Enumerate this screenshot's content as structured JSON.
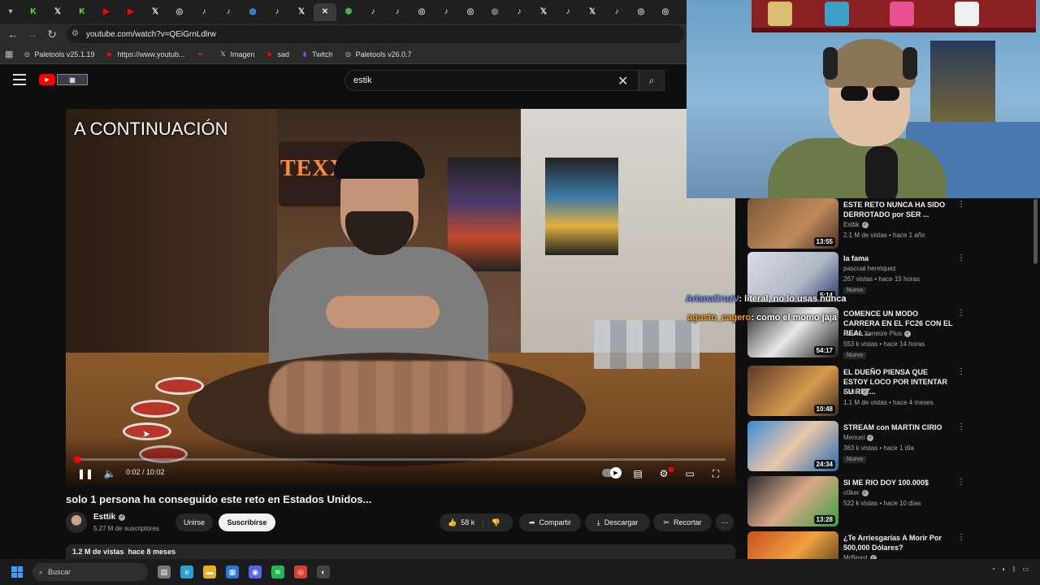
{
  "browser": {
    "tabs": [
      {
        "icon": "k-icon",
        "color": "#53fc18",
        "glyph": "K"
      },
      {
        "icon": "x-icon",
        "color": "#e7e7e7",
        "glyph": "𝕏"
      },
      {
        "icon": "k-icon",
        "color": "#53fc18",
        "glyph": "K"
      },
      {
        "icon": "youtube-icon",
        "color": "#ff0000",
        "glyph": "▶"
      },
      {
        "icon": "youtube-icon",
        "color": "#ff0000",
        "glyph": "▶"
      },
      {
        "icon": "x-icon",
        "color": "#e7e7e7",
        "glyph": "𝕏"
      },
      {
        "icon": "chrome-icon",
        "color": "#cfcfcf",
        "glyph": "◎"
      },
      {
        "icon": "tiktok-icon",
        "color": "#e7e7e7",
        "glyph": "♪"
      },
      {
        "icon": "tiktok-icon",
        "color": "#e7e7e7",
        "glyph": "♪"
      },
      {
        "icon": "globe-icon",
        "color": "#3aa0ff",
        "glyph": "◍"
      },
      {
        "icon": "tiktok-icon",
        "color": "#e7e7e7",
        "glyph": "♪"
      },
      {
        "icon": "x-icon",
        "color": "#e7e7e7",
        "glyph": "𝕏"
      },
      {
        "icon": "close-icon",
        "color": "#e7e7e7",
        "glyph": "✕",
        "active": true
      },
      {
        "icon": "shield-icon",
        "color": "#4caf50",
        "glyph": "⬢"
      },
      {
        "icon": "tiktok-icon",
        "color": "#e7e7e7",
        "glyph": "♪"
      },
      {
        "icon": "tiktok-icon",
        "color": "#e7e7e7",
        "glyph": "♪"
      },
      {
        "icon": "chrome-icon",
        "color": "#cfcfcf",
        "glyph": "◎"
      },
      {
        "icon": "tiktok-icon",
        "color": "#e7e7e7",
        "glyph": "♪"
      },
      {
        "icon": "chrome-icon",
        "color": "#cfcfcf",
        "glyph": "◎"
      },
      {
        "icon": "globe-icon",
        "color": "#888888",
        "glyph": "◍"
      },
      {
        "icon": "tiktok-icon",
        "color": "#e7e7e7",
        "glyph": "♪"
      },
      {
        "icon": "x-icon",
        "color": "#e7e7e7",
        "glyph": "𝕏"
      },
      {
        "icon": "tiktok-icon",
        "color": "#e7e7e7",
        "glyph": "♪"
      },
      {
        "icon": "x-icon",
        "color": "#e7e7e7",
        "glyph": "𝕏"
      },
      {
        "icon": "tiktok-icon",
        "color": "#e7e7e7",
        "glyph": "♪"
      },
      {
        "icon": "chrome-icon",
        "color": "#cfcfcf",
        "glyph": "◎"
      },
      {
        "icon": "chrome-icon",
        "color": "#cfcfcf",
        "glyph": "◎"
      }
    ],
    "url": "youtube.com/watch?v=QEiGrnLdlrw",
    "bookmarks": [
      {
        "label": "Paletools v25.1.19",
        "icon": "chrome-icon",
        "color": "#cfcfcf",
        "glyph": "◎"
      },
      {
        "label": "https://www.youtub...",
        "icon": "youtube-icon",
        "color": "#ff0000",
        "glyph": "▶"
      },
      {
        "label": "",
        "icon": "loop-icon",
        "color": "#ff3355",
        "glyph": "∞"
      },
      {
        "label": "Imagen",
        "icon": "x-icon",
        "color": "#e7e7e7",
        "glyph": "𝕏"
      },
      {
        "label": "sad",
        "icon": "youtube-icon",
        "color": "#ff0000",
        "glyph": "▶"
      },
      {
        "label": "Twitch",
        "icon": "twitch-icon",
        "color": "#9146ff",
        "glyph": "▮"
      },
      {
        "label": "Paletools v26.0.7",
        "icon": "chrome-icon",
        "color": "#cfcfcf",
        "glyph": "◎"
      }
    ]
  },
  "youtube": {
    "search_query": "estik",
    "video": {
      "overlay_text": "A CONTINUACIÓN",
      "sign_text": "TEXX",
      "time": "0:02 / 10:02",
      "progress": 0.003
    },
    "title": "solo 1 persona ha conseguido este reto en Estados Unidos...",
    "channel": {
      "name": "Esttik",
      "subscribers": "5.27 M de suscriptores"
    },
    "join_label": "Unirse",
    "subscribe_label": "Suscribirse",
    "likes": "58 k",
    "share_label": "Compartir",
    "download_label": "Descargar",
    "clip_label": "Recortar",
    "views_line": "1.2 M de vistas  hace 8 meses",
    "recommendations": [
      {
        "title": "ESTE RETO NUNCA HA SIDO DERROTADO por SER ...",
        "channel": "Esttik",
        "verified": true,
        "meta": "2.1 M de vistas • hace 1 año",
        "duration": "13:55",
        "badge": "",
        "thumb": "linear-gradient(135deg,#7a5a3a,#c08a5a 60%,#4a3020)"
      },
      {
        "title": "la fama",
        "channel": "pascual henriquez",
        "verified": false,
        "meta": "267 vistas • hace 15 horas",
        "duration": "5:14",
        "badge": "Nuevo",
        "thumb": "linear-gradient(135deg,#d8dde6,#b0b8c6 60%,#2a3a6a)"
      },
      {
        "title": "COMENCE UN MODO CARRERA EN EL FC26 CON EL REAL ...",
        "channel": "Davoo Xeneize Plus",
        "verified": true,
        "meta": "553 k vistas • hace 14 horas",
        "duration": "54:17",
        "badge": "Nuevo",
        "thumb": "linear-gradient(135deg,#2a2a2a,#e8e8e8 50%,#1a1a1a)"
      },
      {
        "title": "EL DUEÑO PIENSA QUE ESTOY LOCO POR INTENTAR SU RET...",
        "channel": "Esttik",
        "verified": true,
        "meta": "1.1 M de vistas • hace 4 meses",
        "duration": "10:48",
        "badge": "",
        "thumb": "linear-gradient(135deg,#5a3a2a,#d89a50 60%,#3a2a1a)"
      },
      {
        "title": "STREAM con MARTIN CIRIO",
        "channel": "Menuel",
        "verified": true,
        "meta": "363 k vistas • hace 1 día",
        "duration": "24:34",
        "badge": "Nuevo",
        "thumb": "linear-gradient(135deg,#3a8ad8,#e8c8a8 50%,#2a6ab0)"
      },
      {
        "title": "SI ME RIO DOY 100.000$",
        "channel": "c0ker",
        "verified": true,
        "meta": "522 k vistas • hace 10 días",
        "duration": "13:28",
        "badge": "",
        "thumb": "linear-gradient(135deg,#2a2a2a,#d8a888 50%,#3aa040)"
      },
      {
        "title": "¿Te Arriesgarías A Morir Por 500,000 Dólares?",
        "channel": "MrBeast",
        "verified": true,
        "meta": "",
        "duration": "",
        "badge": "",
        "thumb": "linear-gradient(135deg,#c85020,#f0a040 50%,#3a2a1a)"
      }
    ]
  },
  "chat": [
    {
      "user": "ArianaCruzV",
      "message": "literal, no lo usas nunca"
    },
    {
      "user": "agusto_cagero",
      "message": "como el momo jaja"
    }
  ],
  "taskbar": {
    "search_label": "Buscar",
    "apps": [
      {
        "icon": "file-icon",
        "color": "#777777",
        "glyph": "▤"
      },
      {
        "icon": "edge-icon",
        "color": "#2aa0d8",
        "glyph": "e"
      },
      {
        "icon": "folder-icon",
        "color": "#e8b020",
        "glyph": "▬"
      },
      {
        "icon": "store-icon",
        "color": "#2a78d8",
        "glyph": "▦"
      },
      {
        "icon": "discord-icon",
        "color": "#5865f2",
        "glyph": "◉"
      },
      {
        "icon": "spotify-icon",
        "color": "#1db954",
        "glyph": "≋"
      },
      {
        "icon": "chrome-icon",
        "color": "#d84030",
        "glyph": "◎"
      },
      {
        "icon": "obs-icon",
        "color": "#444444",
        "glyph": "◐"
      }
    ]
  },
  "colors": {
    "accent": "#ff0000",
    "bg": "#0f0f0f",
    "pill": "#272727"
  }
}
